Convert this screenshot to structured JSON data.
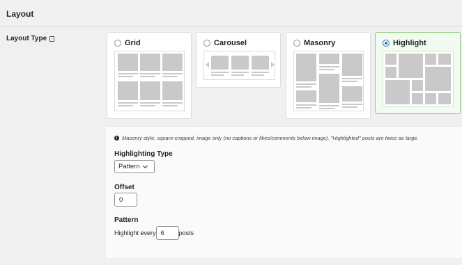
{
  "section": {
    "title": "Layout"
  },
  "layout_type": {
    "label": "Layout Type",
    "options": [
      {
        "label": "Grid",
        "selected": false
      },
      {
        "label": "Carousel",
        "selected": false
      },
      {
        "label": "Masonry",
        "selected": false
      },
      {
        "label": "Highlight",
        "selected": true
      }
    ]
  },
  "details": {
    "note": "Masonry style, square-cropped, image only (no captions or likes/comments below image). \"Highlighted\" posts are twice as large.",
    "highlighting_type": {
      "label": "Highlighting Type",
      "value": "Pattern"
    },
    "offset": {
      "label": "Offset",
      "value": "0"
    },
    "pattern": {
      "label": "Pattern",
      "prefix": "Highlight every",
      "value": "6",
      "suffix": "posts"
    }
  },
  "colors": {
    "accent": "#2271b1",
    "selected_border": "#8fcc7d",
    "selected_bg": "#f2fbef"
  }
}
